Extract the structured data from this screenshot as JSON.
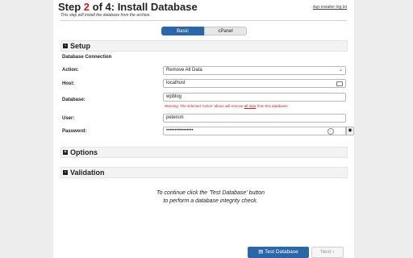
{
  "header": {
    "title_prefix": "Step ",
    "step_current": "2",
    "title_suffix": " of 4: Install Database",
    "subtitle": "This step will install the database from the archive.",
    "log_link": "dup-installer-log.txt"
  },
  "tabs": [
    {
      "label": "Basic",
      "active": true
    },
    {
      "label": "cPanel",
      "active": false
    }
  ],
  "setup": {
    "title": "Setup",
    "toggle": "-",
    "subheading": "Database Connection",
    "fields": {
      "action": {
        "label": "Action:",
        "value": "Remove All Data"
      },
      "host": {
        "label": "Host:",
        "value": "localhost"
      },
      "database": {
        "label": "Database:",
        "value": "wpblog"
      },
      "user": {
        "label": "User:",
        "value": "petersm"
      },
      "password": {
        "label": "Password:",
        "value": "••••••••••••••••"
      }
    },
    "warning_prefix": "Warning: The selected 'Action' above will remove ",
    "warning_link": "all data",
    "warning_suffix": " from this database!"
  },
  "options": {
    "title": "Options",
    "toggle": "+"
  },
  "validation": {
    "title": "Validation",
    "toggle": "-",
    "message_line1": "To continue click the 'Test Database' button",
    "message_line2": "to perform a database integrity check."
  },
  "buttons": {
    "test_database": "Test Database",
    "next": "Next"
  },
  "colors": {
    "primary": "#2a66a8",
    "warning": "#c81e1e",
    "page_background": "#ededed"
  }
}
